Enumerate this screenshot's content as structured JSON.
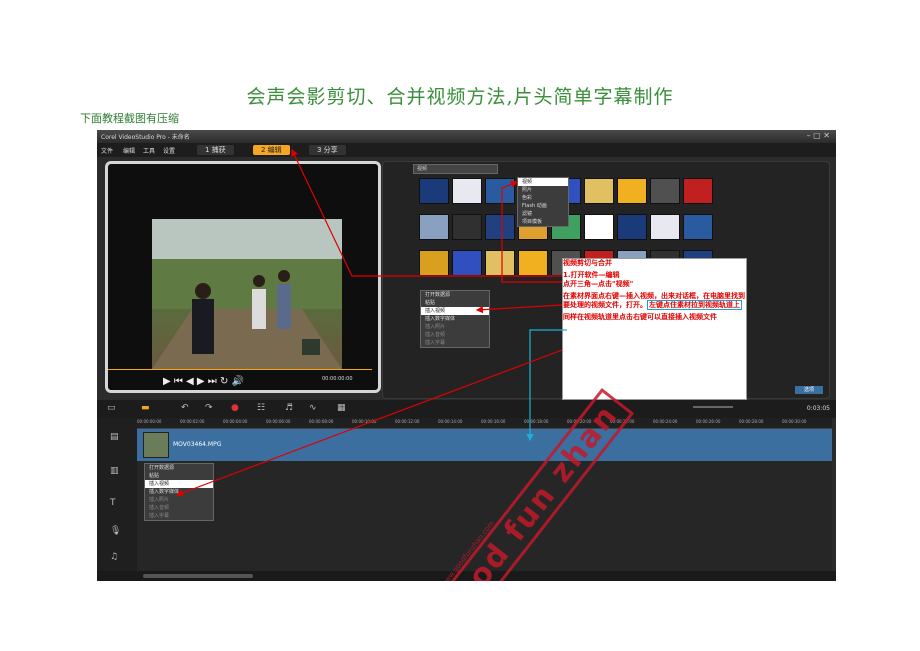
{
  "page": {
    "title": "会声会影剪切、合并视频方法,片头简单字幕制作",
    "note": "下面教程截图有压缩"
  },
  "app": {
    "window_title": "Corel VideoStudio Pro - 未命名",
    "menu": [
      "文件",
      "编辑",
      "工具",
      "设置"
    ],
    "steps": [
      "1 捕获",
      "2 编辑",
      "3 分享"
    ],
    "library_dropdown": "视频",
    "play_label": "项目\n素材",
    "timecode": "00:00:00:00",
    "zoom_timecode": "0:03:05 ",
    "ok_button": "选项",
    "clip_name": "MOV03464.MPG",
    "ruler_ticks": [
      "00:00:00:00",
      "00:00:02:00",
      "00:00:04:00",
      "00:00:06:00",
      "00:00:08:00",
      "00:00:10:00",
      "00:00:12:00",
      "00:00:14:00",
      "00:00:16:00",
      "00:00:18:00",
      "00:00:20:00",
      "00:00:22:00",
      "00:00:24:00",
      "00:00:26:00",
      "00:00:28:00",
      "00:00:30:00"
    ]
  },
  "context_menu_top": [
    "视频",
    "照片",
    "色彩",
    "Flash 动画",
    "滤镜",
    "项目模板"
  ],
  "context_menu_mid": [
    "打开数据源",
    "粘贴",
    "插入视频",
    "插入数字媒体",
    "插入照片",
    "插入音频",
    "插入字幕"
  ],
  "context_menu_timeline": [
    "打开数据源",
    "粘贴",
    "插入视频",
    "插入数字媒体",
    "插入照片",
    "插入音频",
    "插入字幕"
  ],
  "instructions": {
    "heading": "视频剪切与合并",
    "step1a": "1.打开软件—编辑",
    "step1b": "点开三角—点击\"视频\"",
    "step2": "在素材界面点右键—插入视频，出来对话框，在电脑里找到要处理的视频文件，打开。",
    "step2_highlight": "左键点住素材拉到视频轨道上",
    "step3": "同样在视频轨道里点击右键可以直接插入视频文件"
  },
  "watermark": {
    "main": "Good fun zhan",
    "sub": "www.goodfunzhan.com"
  },
  "colors": {
    "title_green": "#3a8f3a",
    "instruction_red": "#e00000",
    "arrow_red": "#e00000",
    "arrow_cyan": "#1ab0d8",
    "step_active": "#f5a623",
    "timeline_blue": "#3a6fa0"
  }
}
